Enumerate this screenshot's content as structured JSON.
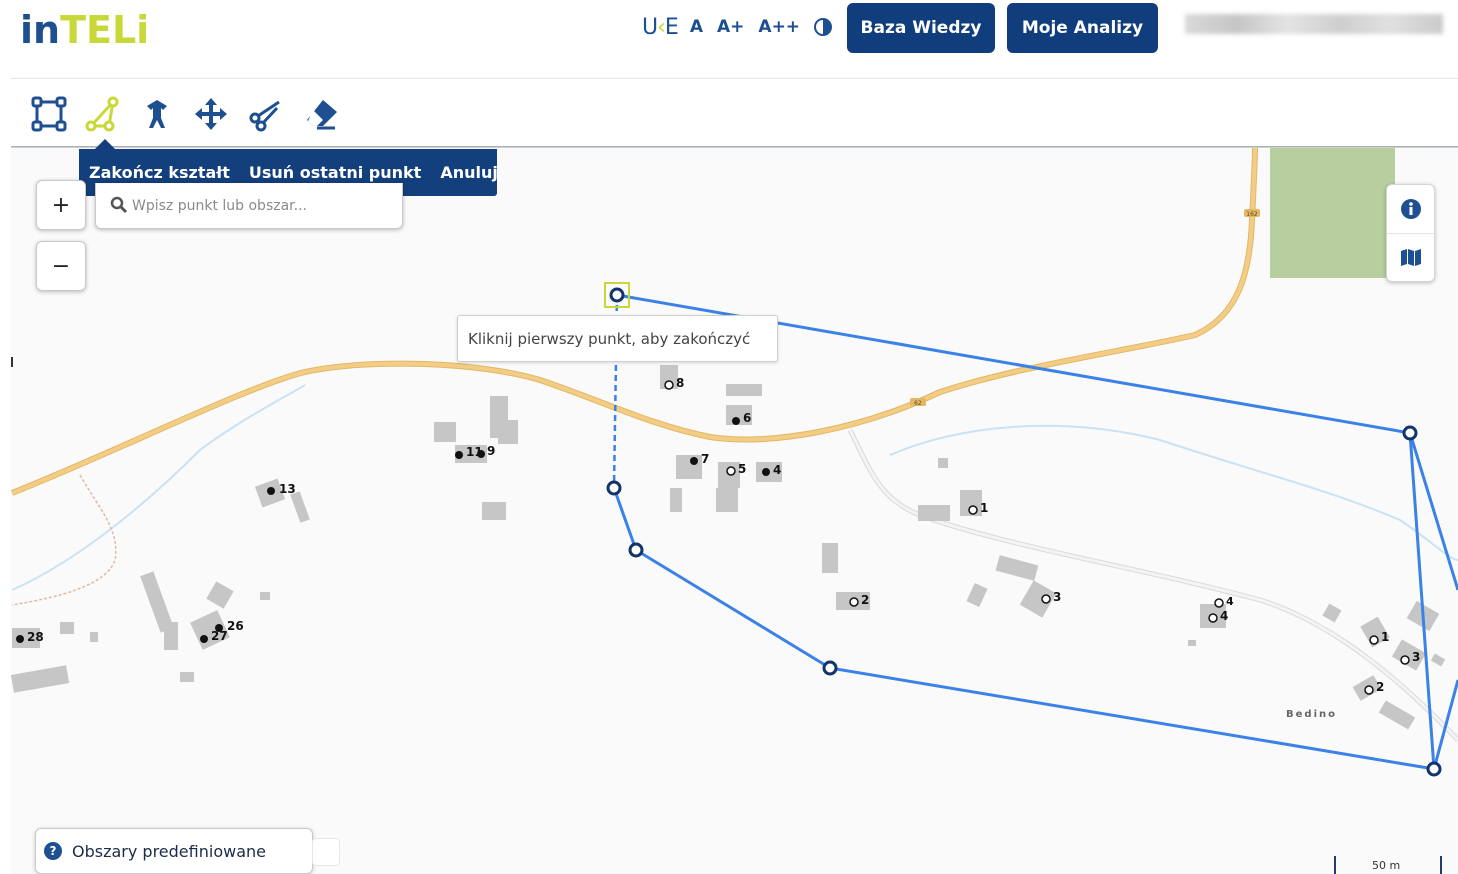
{
  "header": {
    "logo_in": "in",
    "logo_teli": "TELi",
    "uke_u": "U",
    "uke_k": "K",
    "uke_e": "E",
    "font_a": "A",
    "font_a_plus": "A+",
    "font_a_plus_plus": "A++",
    "btn_baza": "Baza Wiedzy",
    "btn_moje": "Moje Analizy"
  },
  "toolbar": {
    "tools": [
      "rectangle-icon",
      "polygon-icon",
      "pin-icon",
      "move-icon",
      "scissors-icon",
      "eraser-icon"
    ],
    "active_tool": "polygon-icon",
    "active_color": "#c8d838",
    "default_color": "#1d4f91"
  },
  "draw_actions": {
    "finish": "Zakończ kształt",
    "undo": "Usuń ostatni punkt",
    "cancel": "Anuluj"
  },
  "search": {
    "placeholder": "Wpisz punkt lub obszar..."
  },
  "zoom": {
    "in": "+",
    "out": "−"
  },
  "tooltip": "Kliknij pierwszy punkt, aby zakończyć",
  "predefined": {
    "label": "Obszary predefiniowane",
    "icon": "?"
  },
  "scale": {
    "label": "50 m"
  },
  "map": {
    "road_labels": [
      "162",
      "62"
    ],
    "place_label": "Bedino",
    "address_points": [
      {
        "label": "8",
        "filled": false
      },
      {
        "label": "6",
        "filled": true
      },
      {
        "label": "7",
        "filled": true
      },
      {
        "label": "5",
        "filled": false
      },
      {
        "label": "4",
        "filled": true
      },
      {
        "label": "1",
        "filled": false
      },
      {
        "label": "2",
        "filled": false
      },
      {
        "label": "3",
        "filled": false
      },
      {
        "label": "4",
        "filled": false
      },
      {
        "label": "4",
        "filled": false
      },
      {
        "label": "1",
        "filled": false
      },
      {
        "label": "3",
        "filled": false
      },
      {
        "label": "2",
        "filled": false
      },
      {
        "label": "13",
        "filled": true
      },
      {
        "label": "11",
        "filled": true
      },
      {
        "label": "9",
        "filled": true
      },
      {
        "label": "26",
        "filled": true
      },
      {
        "label": "27",
        "filled": true
      },
      {
        "label": "28",
        "filled": true
      }
    ],
    "polygon_color": "#3b82e6",
    "vertex_color": "#12346b",
    "road_color": "#f0c36d",
    "park_color": "#b7cf9f"
  }
}
